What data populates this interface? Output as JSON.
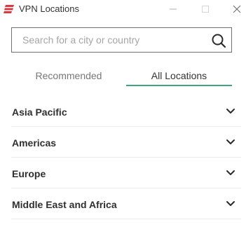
{
  "window": {
    "title": "VPN Locations",
    "logo_icon": "expressvpn-logo-icon",
    "controls": [
      "minimize-icon",
      "maximize-icon",
      "close-icon"
    ],
    "brand_color": "#da3940"
  },
  "search": {
    "placeholder": "Search for a city or country",
    "value": "",
    "icon": "search-icon"
  },
  "tabs": [
    {
      "label": "Recommended",
      "selected": false
    },
    {
      "label": "All Locations",
      "selected": true
    }
  ],
  "accent_color": "#3da67a",
  "regions": [
    {
      "label": "Asia Pacific",
      "icon": "chevron-down-icon"
    },
    {
      "label": "Americas",
      "icon": "chevron-down-icon"
    },
    {
      "label": "Europe",
      "icon": "chevron-down-icon"
    },
    {
      "label": "Middle East and Africa",
      "icon": "chevron-down-icon"
    }
  ]
}
